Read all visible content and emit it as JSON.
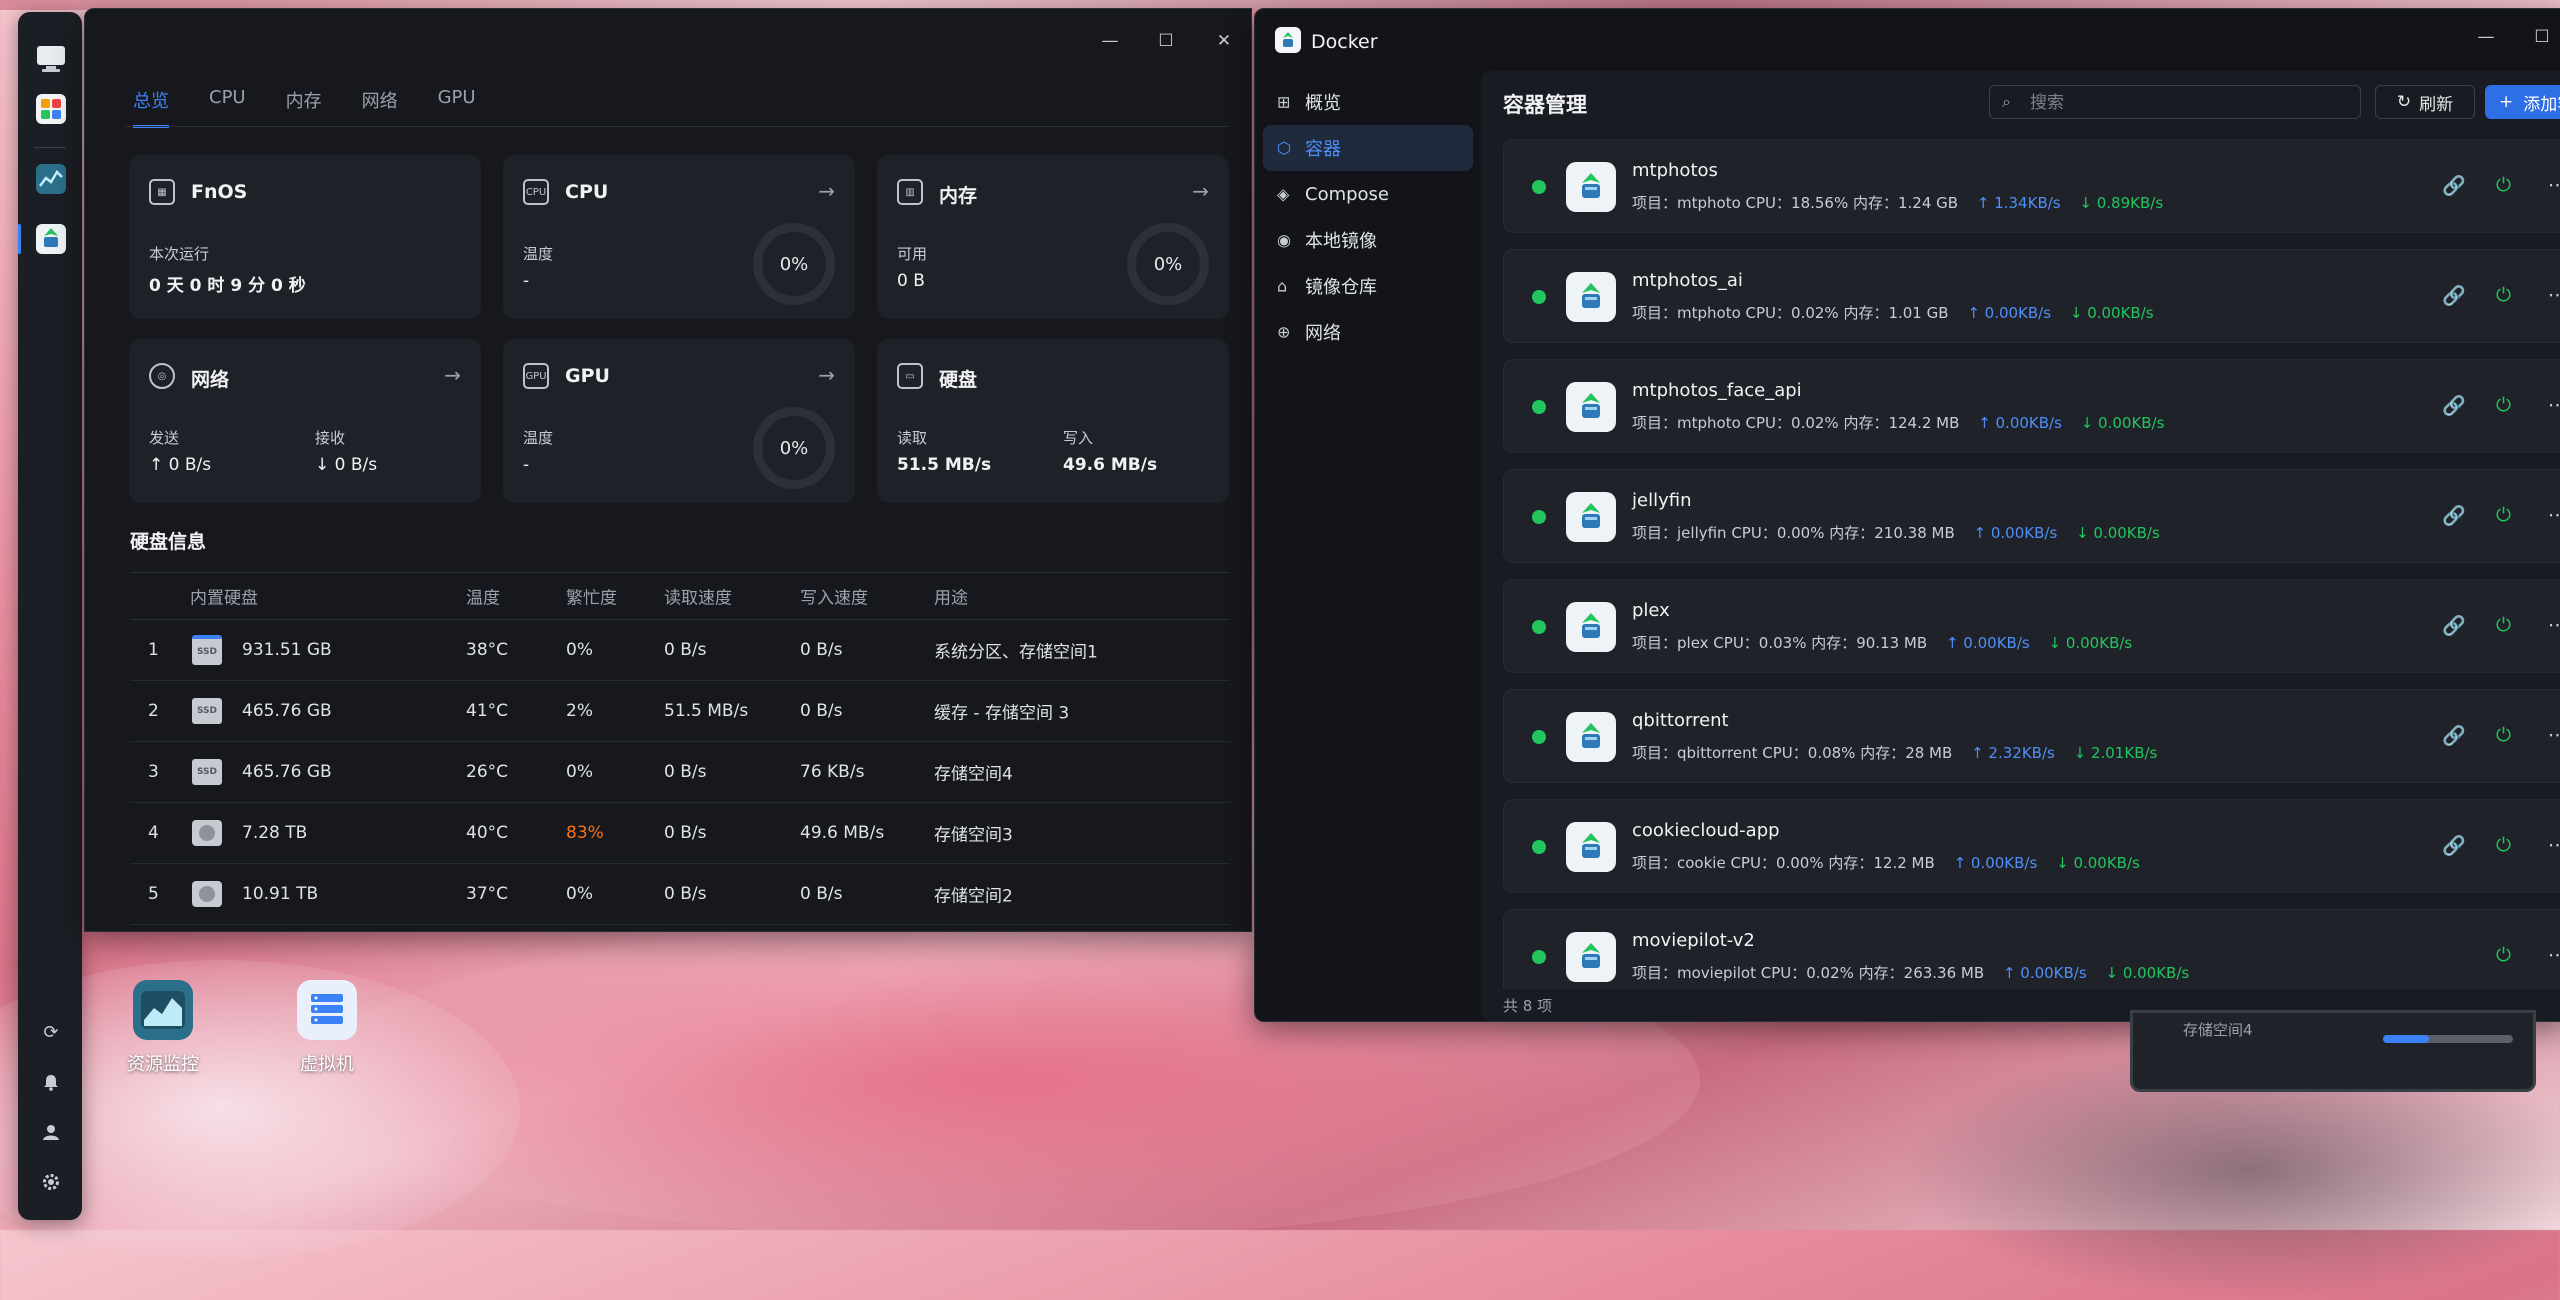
{
  "monitor": {
    "tabs": [
      "总览",
      "CPU",
      "内存",
      "网络",
      "GPU"
    ],
    "cards": {
      "fnos": {
        "title": "FnOS",
        "label": "本次运行",
        "value": "0 天 0 时 9 分 0 秒"
      },
      "cpu": {
        "title": "CPU",
        "label": "温度",
        "value": "-",
        "ring": "0%"
      },
      "mem": {
        "title": "内存",
        "label": "可用",
        "value": "0 B",
        "ring": "0%"
      },
      "net": {
        "title": "网络",
        "send_label": "发送",
        "send_value": "↑ 0 B/s",
        "recv_label": "接收",
        "recv_value": "↓ 0 B/s"
      },
      "gpu": {
        "title": "GPU",
        "label": "温度",
        "value": "-",
        "ring": "0%"
      },
      "disk": {
        "title": "硬盘",
        "read_label": "读取",
        "read_value": "51.5 MB/s",
        "write_label": "写入",
        "write_value": "49.6 MB/s"
      }
    },
    "disk_info": {
      "title": "硬盘信息",
      "headers": [
        "内置硬盘",
        "温度",
        "繁忙度",
        "读取速度",
        "写入速度",
        "用途"
      ],
      "rows": [
        {
          "idx": "1",
          "icon": "nvme-icon",
          "size": "931.51 GB",
          "temp": "38°C",
          "busy": "0%",
          "read": "0 B/s",
          "write": "0 B/s",
          "use": "系统分区、存储空间1"
        },
        {
          "idx": "2",
          "icon": "ssd-icon",
          "size": "465.76 GB",
          "temp": "41°C",
          "busy": "2%",
          "read": "51.5 MB/s",
          "write": "0 B/s",
          "use": "缓存 - 存储空间 3"
        },
        {
          "idx": "3",
          "icon": "ssd-icon",
          "size": "465.76 GB",
          "temp": "26°C",
          "busy": "0%",
          "read": "0 B/s",
          "write": "76 KB/s",
          "use": "存储空间4"
        },
        {
          "idx": "4",
          "icon": "hdd-icon",
          "size": "7.28 TB",
          "temp": "40°C",
          "busy": "83%",
          "read": "0 B/s",
          "write": "49.6 MB/s",
          "use": "存储空间3"
        },
        {
          "idx": "5",
          "icon": "hdd-icon",
          "size": "10.91 TB",
          "temp": "37°C",
          "busy": "0%",
          "read": "0 B/s",
          "write": "0 B/s",
          "use": "存储空间2"
        }
      ],
      "busy_warning_color": "#f97316"
    }
  },
  "docker": {
    "window_title": "Docker",
    "sidebar": [
      {
        "label": "概览",
        "icon": "grid-icon"
      },
      {
        "label": "容器",
        "icon": "cube-icon",
        "active": true
      },
      {
        "label": "Compose",
        "icon": "layers-icon"
      },
      {
        "label": "本地镜像",
        "icon": "disc-icon"
      },
      {
        "label": "镜像仓库",
        "icon": "store-icon"
      },
      {
        "label": "网络",
        "icon": "globe-icon"
      }
    ],
    "page_title": "容器管理",
    "search_placeholder": "搜索",
    "refresh_label": "刷新",
    "add_label": "添加容器",
    "containers": [
      {
        "name": "mtphotos",
        "meta": "项目：mtphoto   CPU：18.56%   内存：1.24 GB",
        "up": "1.34KB/s",
        "down": "0.89KB/s"
      },
      {
        "name": "mtphotos_ai",
        "meta": "项目：mtphoto   CPU：0.02%   内存：1.01 GB",
        "up": "0.00KB/s",
        "down": "0.00KB/s"
      },
      {
        "name": "mtphotos_face_api",
        "meta": "项目：mtphoto   CPU：0.02%   内存：124.2 MB",
        "up": "0.00KB/s",
        "down": "0.00KB/s"
      },
      {
        "name": "jellyfin",
        "meta": "项目：jellyfin   CPU：0.00%   内存：210.38 MB",
        "up": "0.00KB/s",
        "down": "0.00KB/s"
      },
      {
        "name": "plex",
        "meta": "项目：plex   CPU：0.03%   内存：90.13 MB",
        "up": "0.00KB/s",
        "down": "0.00KB/s"
      },
      {
        "name": "qbittorrent",
        "meta": "项目：qbittorrent   CPU：0.08%   内存：28 MB",
        "up": "2.32KB/s",
        "down": "2.01KB/s"
      },
      {
        "name": "cookiecloud-app",
        "meta": "项目：cookie   CPU：0.00%   内存：12.2 MB",
        "up": "0.00KB/s",
        "down": "0.00KB/s"
      },
      {
        "name": "moviepilot-v2",
        "meta": "项目：moviepilot   CPU：0.02%   内存：263.36 MB",
        "up": "0.00KB/s",
        "down": "0.00KB/s"
      }
    ],
    "total": "共 8 项"
  },
  "peek_window": {
    "label": "存储空间4",
    "fill": 0.35
  },
  "desktop": {
    "icons": [
      {
        "label": "资源监控",
        "icon": "monitor-chart-icon"
      },
      {
        "label": "虚拟机",
        "icon": "server-icon"
      }
    ]
  },
  "colors": {
    "accent": "#3b82f6",
    "running": "#22c55e"
  }
}
